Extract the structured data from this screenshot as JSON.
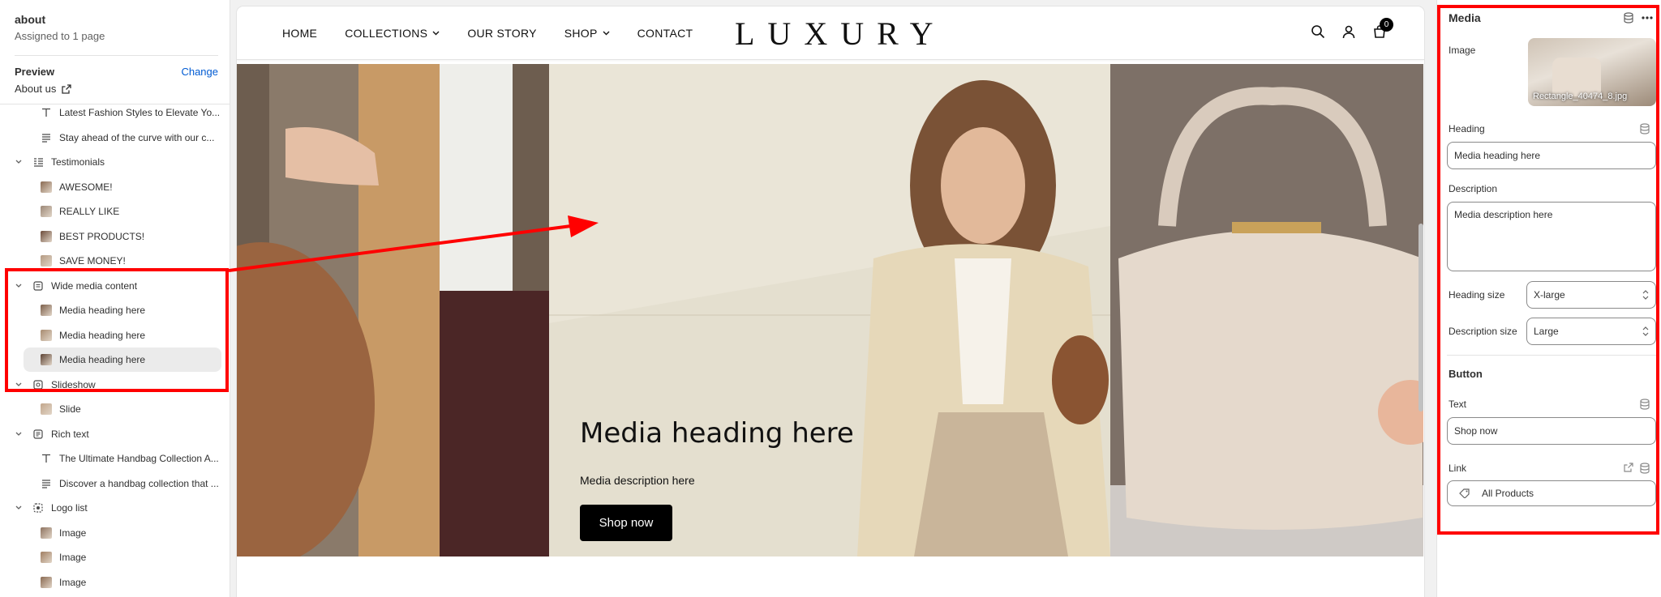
{
  "sidebar": {
    "title": "about",
    "subtitle": "Assigned to 1 page",
    "preview_label": "Preview",
    "change_label": "Change",
    "preview_page": "About us",
    "tree": [
      {
        "kind": "child",
        "icon": "text-icon",
        "label": "Latest Fashion Styles to Elevate Yo..."
      },
      {
        "kind": "child",
        "icon": "paragraph-icon",
        "label": "Stay ahead of the curve with our c..."
      },
      {
        "kind": "section",
        "icon": "testimonials-icon",
        "label": "Testimonials"
      },
      {
        "kind": "child",
        "icon": "thumb-image",
        "label": "AWESOME!"
      },
      {
        "kind": "child",
        "icon": "thumb-image",
        "label": "REALLY LIKE"
      },
      {
        "kind": "child",
        "icon": "thumb-image",
        "label": "BEST PRODUCTS!"
      },
      {
        "kind": "child",
        "icon": "thumb-image",
        "label": "SAVE MONEY!"
      },
      {
        "kind": "section",
        "icon": "media-section-icon",
        "label": "Wide media content"
      },
      {
        "kind": "child",
        "icon": "thumb-image",
        "label": "Media heading here"
      },
      {
        "kind": "child",
        "icon": "thumb-image",
        "label": "Media heading here"
      },
      {
        "kind": "child",
        "icon": "thumb-image",
        "label": "Media heading here",
        "selected": true
      },
      {
        "kind": "section",
        "icon": "slideshow-icon",
        "label": "Slideshow"
      },
      {
        "kind": "child",
        "icon": "thumb-image",
        "label": "Slide"
      },
      {
        "kind": "section",
        "icon": "rich-text-icon",
        "label": "Rich text"
      },
      {
        "kind": "child",
        "icon": "text-icon",
        "label": "The Ultimate Handbag Collection A..."
      },
      {
        "kind": "child",
        "icon": "paragraph-icon",
        "label": "Discover a handbag collection that ..."
      },
      {
        "kind": "section",
        "icon": "logo-list-icon",
        "label": "Logo list"
      },
      {
        "kind": "child",
        "icon": "thumb-image",
        "label": "Image"
      },
      {
        "kind": "child",
        "icon": "thumb-image",
        "label": "Image"
      },
      {
        "kind": "child",
        "icon": "thumb-image",
        "label": "Image"
      }
    ]
  },
  "store": {
    "nav": [
      {
        "label": "HOME",
        "dropdown": false
      },
      {
        "label": "COLLECTIONS",
        "dropdown": true
      },
      {
        "label": "OUR STORY",
        "dropdown": false
      },
      {
        "label": "SHOP",
        "dropdown": true
      },
      {
        "label": "CONTACT",
        "dropdown": false
      }
    ],
    "logo": "LUXURY",
    "cart_count": "0",
    "hero": {
      "heading": "Media heading here",
      "description": "Media description here",
      "button": "Shop now"
    }
  },
  "settings": {
    "title": "Media",
    "image_label": "Image",
    "image_filename": "Rectangle_40474_8.jpg",
    "heading_label": "Heading",
    "heading_value": "Media heading here",
    "description_label": "Description",
    "description_value": "Media description here",
    "heading_size_label": "Heading size",
    "heading_size_value": "X-large",
    "description_size_label": "Description size",
    "description_size_value": "Large",
    "button_section": "Button",
    "text_label": "Text",
    "text_value": "Shop now",
    "link_label": "Link",
    "link_value": "All Products"
  },
  "colors": {
    "annotation": "#ff0000",
    "accent_link": "#005bd3",
    "selected_row": "#ebebeb"
  }
}
